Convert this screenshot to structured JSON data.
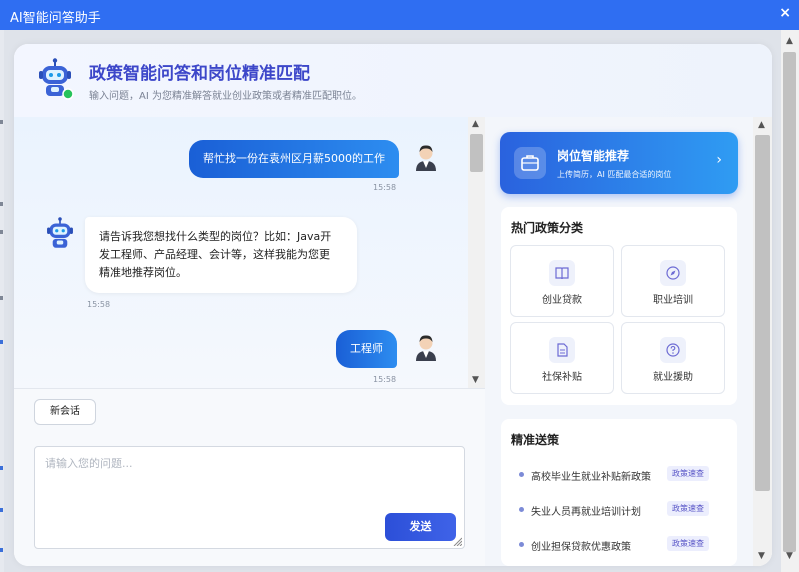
{
  "window": {
    "title": "AI智能问答助手",
    "close_glyph": "×"
  },
  "header": {
    "title": "政策智能问答和岗位精准匹配",
    "subtitle": "输入问题，AI 为您精准解答就业创业政策或者精准匹配职位。"
  },
  "messages": [
    {
      "role": "user",
      "text": "帮忙找一份在袁州区月薪5000的工作",
      "time": "15:58"
    },
    {
      "role": "bot",
      "lines": [
        "请告诉我您想找什么类型的岗位？比如：Java开",
        "发工程师、产品经理、会计等，这样我能为您更",
        "精准地推荐岗位。"
      ],
      "time": "15:58"
    },
    {
      "role": "user",
      "text": "工程师",
      "time": "15:58"
    }
  ],
  "composer": {
    "new_chat_label": "新会话",
    "placeholder": "请输入您的问题...",
    "value": "",
    "send_label": "发送"
  },
  "recommend": {
    "title": "岗位智能推荐",
    "subtitle": "上传简历，AI 匹配最合适的岗位",
    "chevron": "›"
  },
  "hot_categories": {
    "title": "热门政策分类",
    "items": [
      {
        "label": "创业贷款",
        "icon": "book-icon"
      },
      {
        "label": "职业培训",
        "icon": "compass-icon"
      },
      {
        "label": "社保补贴",
        "icon": "document-icon"
      },
      {
        "label": "就业援助",
        "icon": "help-icon"
      }
    ]
  },
  "precise": {
    "title": "精准送策",
    "items": [
      {
        "text": "高校毕业生就业补贴新政策",
        "tag": "政策速查"
      },
      {
        "text": "失业人员再就业培训计划",
        "tag": "政策速查"
      },
      {
        "text": "创业担保贷款优惠政策",
        "tag": "政策速查"
      }
    ]
  },
  "colors": {
    "accent": "#2f6ef2",
    "title": "#3d47c9",
    "send": "#2c4fd8"
  }
}
